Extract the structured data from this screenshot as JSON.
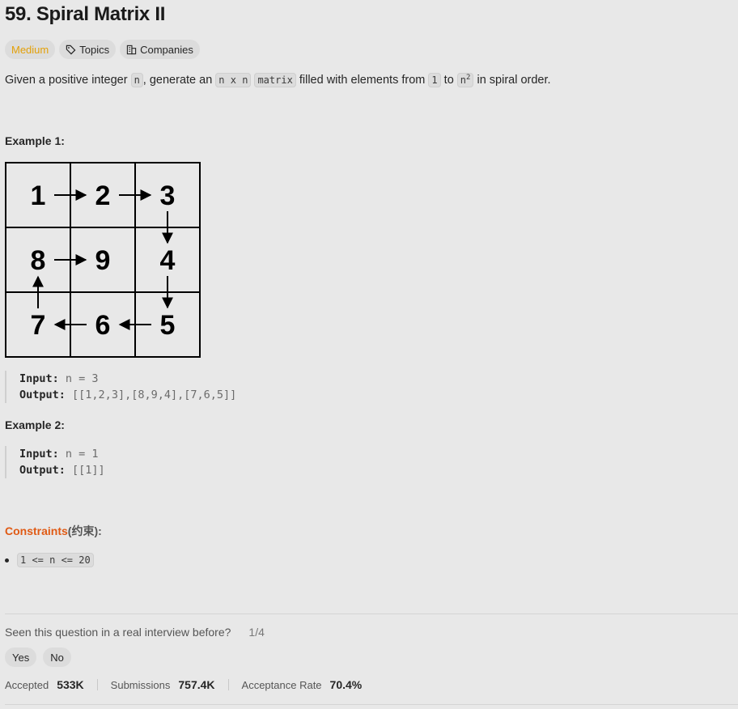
{
  "problem": {
    "title": "59. Spiral Matrix II",
    "tags": {
      "difficulty": "Medium",
      "topics": "Topics",
      "companies": "Companies"
    },
    "description": {
      "part1": "Given a positive integer ",
      "code_n": "n",
      "part2": ", generate an ",
      "code_nxn": "n x n",
      "code_matrix": "matrix",
      "part3": " filled with elements from ",
      "code_1": "1",
      "part4": " to ",
      "code_n2_base": "n",
      "code_n2_exp": "2",
      "part5": " in spiral order."
    },
    "example1": {
      "title": "Example 1:",
      "grid": [
        [
          "1",
          "2",
          "3"
        ],
        [
          "8",
          "9",
          "4"
        ],
        [
          "7",
          "6",
          "5"
        ]
      ],
      "input_label": "Input:",
      "input_value": "n = 3",
      "output_label": "Output:",
      "output_value": "[[1,2,3],[8,9,4],[7,6,5]]"
    },
    "example2": {
      "title": "Example 2:",
      "input_label": "Input:",
      "input_value": "n = 1",
      "output_label": "Output:",
      "output_value": "[[1]]"
    },
    "constraints": {
      "title": "Constraints",
      "title_cn": "(约束):",
      "items": [
        "1 <= n <= 20"
      ]
    },
    "interview": {
      "question": "Seen this question in a real interview before?",
      "fraction": "1/4",
      "yes": "Yes",
      "no": "No"
    },
    "stats": {
      "accepted_label": "Accepted",
      "accepted_value": "533K",
      "submissions_label": "Submissions",
      "submissions_value": "757.4K",
      "acceptance_label": "Acceptance Rate",
      "acceptance_value": "70.4%"
    },
    "colors": {
      "medium": "#e3a008",
      "constraints": "#e05a14",
      "background": "#e8e8e8"
    },
    "icons": [
      "tag-icon",
      "building-icon"
    ]
  }
}
